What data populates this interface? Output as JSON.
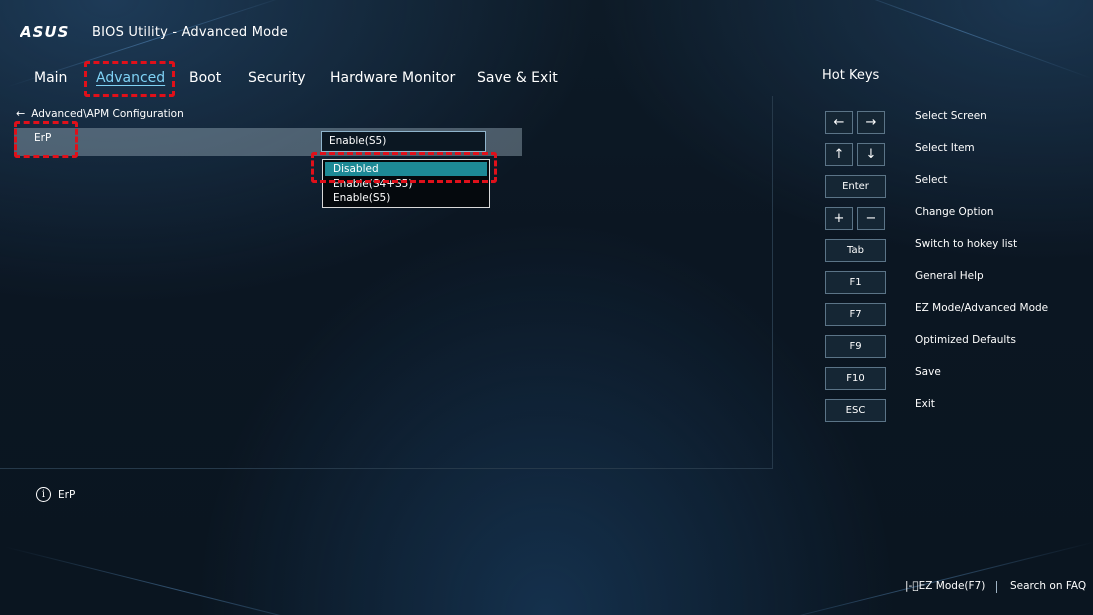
{
  "header": {
    "brand": "ASUS",
    "title": "BIOS Utility - Advanced Mode"
  },
  "nav": {
    "tabs": [
      {
        "label": "Main",
        "active": false
      },
      {
        "label": "Advanced",
        "active": true
      },
      {
        "label": "Boot",
        "active": false
      },
      {
        "label": "Security",
        "active": false
      },
      {
        "label": "Hardware Monitor",
        "active": false
      },
      {
        "label": "Save & Exit",
        "active": false
      }
    ]
  },
  "breadcrumb": {
    "path": "Advanced\\APM Configuration"
  },
  "settings": {
    "erp": {
      "label": "ErP",
      "value": "Enable(S5)",
      "options": [
        "Disabled",
        "Enable(S4+S5)",
        "Enable(S5)"
      ],
      "highlighted_option": "Disabled"
    }
  },
  "help": {
    "text": "ErP"
  },
  "hotkeys": {
    "title": "Hot Keys",
    "items": [
      {
        "keys": [
          "←",
          "→"
        ],
        "description": "Select Screen"
      },
      {
        "keys": [
          "↑",
          "↓"
        ],
        "description": "Select Item"
      },
      {
        "keys": [
          "Enter"
        ],
        "description": "Select"
      },
      {
        "keys": [
          "+",
          "−"
        ],
        "description": "Change Option"
      },
      {
        "keys": [
          "Tab"
        ],
        "description": "Switch to hokey list"
      },
      {
        "keys": [
          "F1"
        ],
        "description": "General Help"
      },
      {
        "keys": [
          "F7"
        ],
        "description": "EZ Mode/Advanced Mode"
      },
      {
        "keys": [
          "F9"
        ],
        "description": "Optimized Defaults"
      },
      {
        "keys": [
          "F10"
        ],
        "description": "Save"
      },
      {
        "keys": [
          "ESC"
        ],
        "description": "Exit"
      }
    ]
  },
  "footer": {
    "ez_mode": "EZ Mode(F7)",
    "search": "Search on FAQ"
  },
  "colors": {
    "accent_active_tab": "#7fd2f5",
    "selected_option": "#1d8a96",
    "annotation_red": "#e0101a"
  }
}
